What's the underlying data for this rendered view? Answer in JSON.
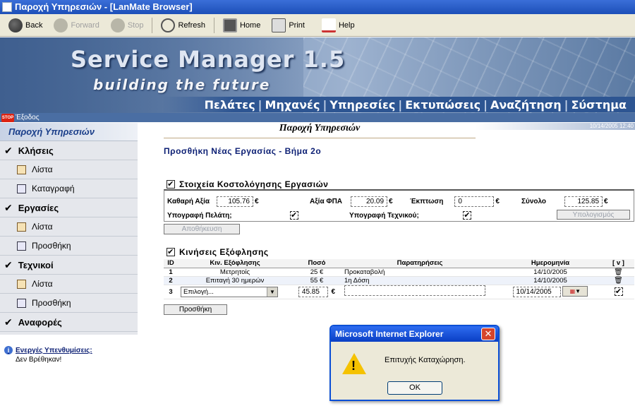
{
  "window": {
    "title": "Παροχή Υπηρεσιών - [LanMate Browser]"
  },
  "toolbar": {
    "back": "Back",
    "forward": "Forward",
    "stop": "Stop",
    "refresh": "Refresh",
    "home": "Home",
    "print": "Print",
    "help": "Help"
  },
  "banner": {
    "title": "Service Manager 1.5",
    "subtitle": "building the future",
    "nav": [
      "Πελάτες",
      "Μηχανές",
      "Υπηρεσίες",
      "Εκτυπώσεις",
      "Αναζήτηση",
      "Σύστημα"
    ]
  },
  "exit": {
    "icon_text": "STOP",
    "label": "Έξοδος"
  },
  "sidebar": {
    "header": "Παροχή Υπηρεσιών",
    "calls": "Κλήσεις",
    "calls_list": "Λίστα",
    "calls_register": "Καταγραφή",
    "tasks": "Εργασίες",
    "tasks_list": "Λίστα",
    "tasks_add": "Προσθήκη",
    "technicians": "Τεχνικοί",
    "technicians_list": "Λίστα",
    "technicians_add": "Προσθήκη",
    "reports": "Αναφορές"
  },
  "reminders": {
    "title": "Ενεργές Υπενθυμίσεις:",
    "none": "Δεν Βρέθηκαν!"
  },
  "main": {
    "header": "Παροχή Υπηρεσιών",
    "date": "10/14/2005 12:40",
    "step_title": "Προσθήκη Νέας Εργασίας - Βήμα 2ο"
  },
  "cost": {
    "title": "Στοιχεία Κοστολόγησης Εργασιών",
    "net_label": "Καθαρή Αξία",
    "net_value": "105.76",
    "vat_label": "Αξία ΦΠΑ",
    "vat_value": "20.09",
    "discount_label": "Έκπτωση",
    "discount_value": "0",
    "total_label": "Σύνολο",
    "total_value": "125.85",
    "currency": "€",
    "client_sig_label": "Υπογραφή Πελάτη;",
    "tech_sig_label": "Υπογραφή Τεχνικού;",
    "calc_button": "Υπολογισμός",
    "save_button": "Αποθήκευση"
  },
  "payments": {
    "title": "Κινήσεις Εξόφλησης",
    "headers": [
      "ID",
      "Κιν. Εξόφλησης",
      "Ποσό",
      "Παρατηρήσεις",
      "Ημερομηνία",
      "[ v ]"
    ],
    "rows": [
      {
        "id": "1",
        "type": "Μετρητοίς",
        "amount": "25 €",
        "notes": "Προκαταβολή",
        "date": "14/10/2005"
      },
      {
        "id": "2",
        "type": "Επιταγή 30 ημερών",
        "amount": "55 €",
        "notes": "1η Δόση",
        "date": "14/10/2005"
      }
    ],
    "new_row": {
      "id": "3",
      "select_value": "Επιλογή...",
      "amount": "45.85",
      "currency": "€",
      "notes": "",
      "date": "10/14/2005"
    },
    "add_button": "Προσθήκη"
  },
  "dialog": {
    "title": "Microsoft Internet Explorer",
    "message": "Επιτυχής Καταχώρηση.",
    "ok": "OK"
  }
}
